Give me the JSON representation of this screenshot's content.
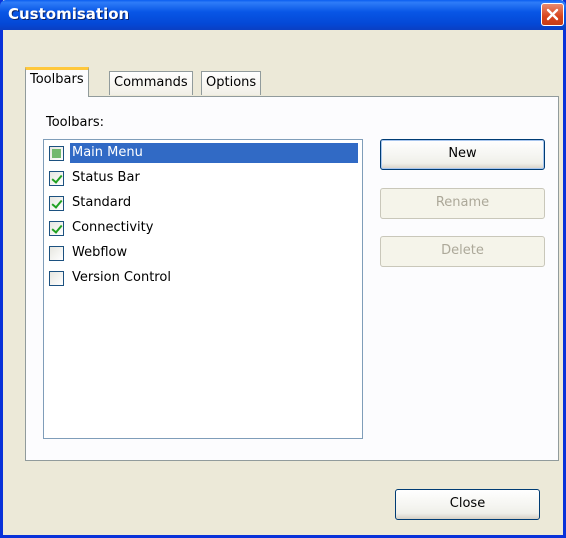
{
  "window": {
    "title": "Customisation"
  },
  "tabs": [
    {
      "label": "Toolbars",
      "active": true
    },
    {
      "label": "Commands",
      "active": false
    },
    {
      "label": "Options",
      "active": false
    }
  ],
  "toolbars": {
    "label": "Toolbars:",
    "items": [
      {
        "label": "Main Menu",
        "state": "mixed",
        "selected": true
      },
      {
        "label": "Status Bar",
        "state": "checked",
        "selected": false
      },
      {
        "label": "Standard",
        "state": "checked",
        "selected": false
      },
      {
        "label": "Connectivity",
        "state": "checked",
        "selected": false
      },
      {
        "label": "Webflow",
        "state": "unchecked",
        "selected": false
      },
      {
        "label": "Version Control",
        "state": "unchecked",
        "selected": false
      }
    ]
  },
  "buttons": {
    "new": {
      "label": "New",
      "enabled": true
    },
    "rename": {
      "label": "Rename",
      "enabled": false
    },
    "delete": {
      "label": "Delete",
      "enabled": false
    },
    "close": {
      "label": "Close",
      "enabled": true
    }
  },
  "colors": {
    "titlebar": "#0856e6",
    "selection": "#316ac5",
    "dialog_bg": "#ece9d8",
    "check": "#21a121"
  },
  "icons": {
    "close": "close-icon"
  }
}
